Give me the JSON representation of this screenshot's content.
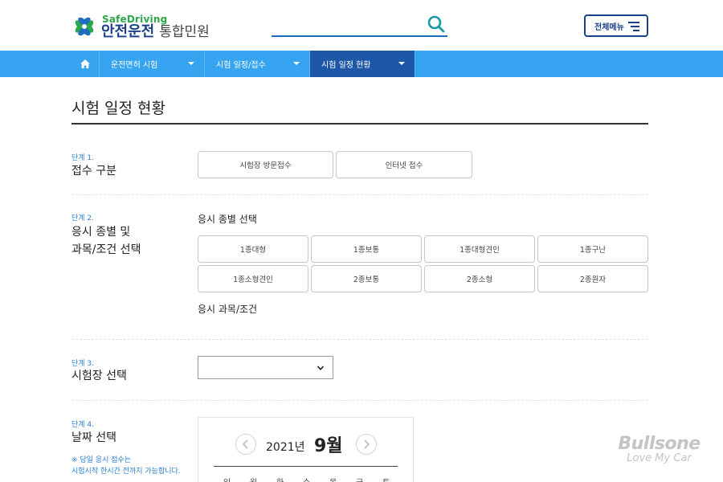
{
  "header": {
    "logo": {
      "top": "SafeDriving",
      "brand": "안전운전",
      "sub": "통합민원"
    },
    "search": {
      "placeholder": ""
    },
    "menu_label": "전체메뉴"
  },
  "nav": {
    "items": [
      {
        "label": "운전면허 시험"
      },
      {
        "label": "시험 일정/접수"
      },
      {
        "label": "시험 일정 현황"
      }
    ]
  },
  "page": {
    "title": "시험 일정 현황"
  },
  "steps": {
    "s1": {
      "label": "단계 1.",
      "title": "접수 구분",
      "options": [
        "시험장 방문접수",
        "인터넷 접수"
      ]
    },
    "s2": {
      "label": "단계 2.",
      "title_line1": "응시 종별 및",
      "title_line2": "과목/조건 선택",
      "heading": "응시 종별 선택",
      "options": [
        "1종대형",
        "1종보통",
        "1종대형견인",
        "1종구난",
        "1종소형견인",
        "2종보통",
        "2종소형",
        "2종원자"
      ],
      "subject_heading": "응시 과목/조건"
    },
    "s3": {
      "label": "단계 3.",
      "title": "시험장 선택",
      "selected": ""
    },
    "s4": {
      "label": "단계 4.",
      "title": "날짜 선택",
      "note_line1": "※ 당일 응시 접수는",
      "note_line2": "시험시작 한시간 전까지 가능합니다."
    }
  },
  "calendar": {
    "year": "2021년",
    "month": "9월",
    "weekdays": [
      "일",
      "월",
      "화",
      "수",
      "목",
      "금",
      "토"
    ]
  },
  "watermark": {
    "main": "Bullsone",
    "sub": "Love My Car"
  },
  "colors": {
    "nav": "#37a4f2",
    "nav_active": "#1d58a8",
    "brand": "#1b3f8a",
    "accent": "#2a7fd4",
    "logo_green": "#2aa84a"
  }
}
